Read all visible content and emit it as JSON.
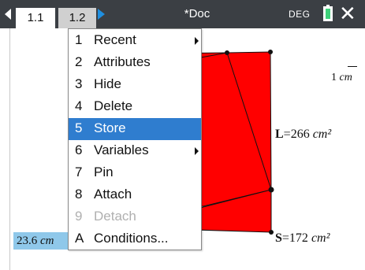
{
  "header": {
    "tabs": [
      {
        "label": "1.1"
      },
      {
        "label": "1.2"
      }
    ],
    "document_title": "*Doc",
    "angle_mode": "DEG",
    "close_symbol": "✕"
  },
  "canvas": {
    "scale_label_num": "1",
    "scale_label_unit": "cm",
    "measure_l": {
      "name": "L",
      "eq": "=266 ",
      "unit": "cm²"
    },
    "measure_s": {
      "name": "S",
      "eq": "=172 ",
      "unit": "cm²"
    },
    "selected_value": "23.6 ",
    "selected_unit": "cm",
    "shape_color": "#ff0000"
  },
  "context_menu": {
    "items": [
      {
        "key": "1",
        "label": "Recent",
        "submenu": true
      },
      {
        "key": "2",
        "label": "Attributes"
      },
      {
        "key": "3",
        "label": "Hide"
      },
      {
        "key": "4",
        "label": "Delete"
      },
      {
        "key": "5",
        "label": "Store",
        "highlighted": true
      },
      {
        "key": "6",
        "label": "Variables",
        "submenu": true
      },
      {
        "key": "7",
        "label": "Pin"
      },
      {
        "key": "8",
        "label": "Attach"
      },
      {
        "key": "9",
        "label": "Detach",
        "disabled": true
      },
      {
        "key": "A",
        "label": "Conditions..."
      }
    ],
    "highlight_color": "#2f7dcf"
  }
}
